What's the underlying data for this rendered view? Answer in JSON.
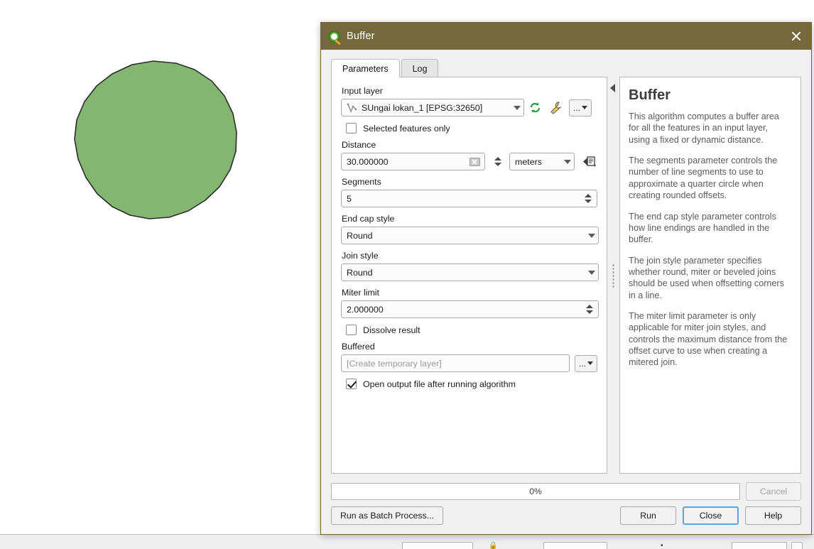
{
  "window": {
    "title": "Buffer",
    "logo_icon": "qgis-logo-icon",
    "close_icon": "close-icon"
  },
  "tabs": [
    {
      "label": "Parameters",
      "active": true
    },
    {
      "label": "Log",
      "active": false
    }
  ],
  "splitter": {
    "collapse_icon": "collapse-left-triangle-icon",
    "grip_icon": "splitter-grip-icon"
  },
  "parameters": {
    "input_layer": {
      "label": "Input layer",
      "value": "SUngai lokan_1 [EPSG:32650]",
      "geometry_icon": "line-geometry-icon",
      "refresh_icon": "refresh-iterate-icon",
      "wrench_icon": "wrench-icon",
      "browse_label": "...",
      "caret_icon": "chevron-down-icon"
    },
    "selected_features_only": {
      "label": "Selected features only",
      "checked": false
    },
    "distance": {
      "label": "Distance",
      "value": "30.000000",
      "clear_icon": "clear-x-icon",
      "units_value": "meters",
      "data_defined_icon": "data-defined-override-icon"
    },
    "segments": {
      "label": "Segments",
      "value": "5"
    },
    "end_cap_style": {
      "label": "End cap style",
      "value": "Round"
    },
    "join_style": {
      "label": "Join style",
      "value": "Round"
    },
    "miter_limit": {
      "label": "Miter limit",
      "value": "2.000000"
    },
    "dissolve_result": {
      "label": "Dissolve result",
      "checked": false
    },
    "buffered": {
      "label": "Buffered",
      "placeholder": "[Create temporary layer]",
      "value": "[Create temporary layer]",
      "browse_label": "..."
    },
    "open_output": {
      "label": "Open output file after running algorithm",
      "checked": true
    }
  },
  "help": {
    "title": "Buffer",
    "paragraphs": [
      "This algorithm computes a buffer area for all the features in an input layer, using a fixed or dynamic distance.",
      "The segments parameter controls the number of line segments to use to approximate a quarter circle when creating rounded offsets.",
      "The end cap style parameter controls how line endings are handled in the buffer.",
      "The join style parameter specifies whether round, miter or beveled joins should be used when offsetting corners in a line.",
      "The miter limit parameter is only applicable for miter join styles, and controls the maximum distance from the offset curve to use when creating a mitered join."
    ]
  },
  "footer": {
    "progress_text": "0%",
    "progress_percent": 0,
    "cancel_label": "Cancel",
    "cancel_enabled": false,
    "batch_label": "Run as Batch Process...",
    "run_label": "Run",
    "close_label": "Close",
    "help_label": "Help"
  },
  "map": {
    "layer_fill_color": "#84b571",
    "layer_stroke_color": "#2c2c2c",
    "background_color": "#ffffff"
  }
}
